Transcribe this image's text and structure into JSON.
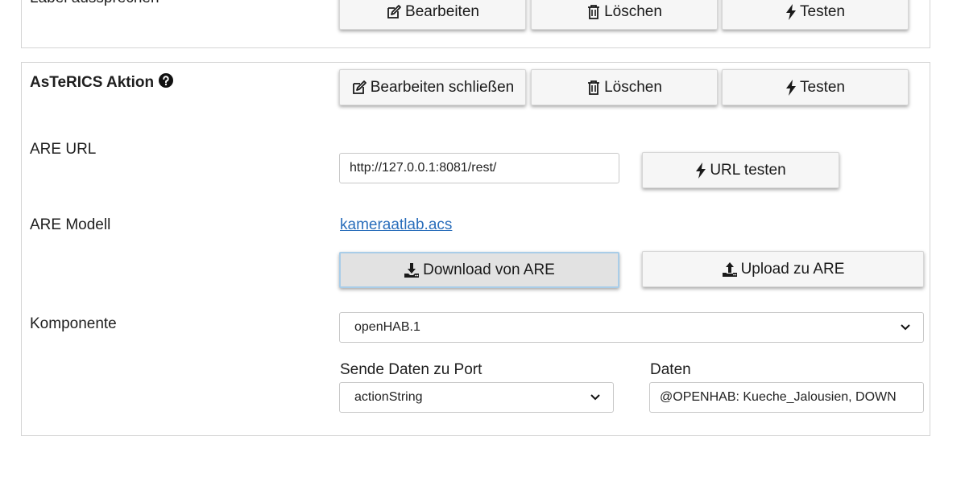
{
  "top_section": {
    "label": "Label aussprechen",
    "edit_label": "Bearbeiten",
    "delete_label": "Löschen",
    "test_label": "Testen"
  },
  "asterics": {
    "title": "AsTeRICS Aktion",
    "close_edit_label": "Bearbeiten schließen",
    "delete_label": "Löschen",
    "test_label": "Testen",
    "are_url_label": "ARE URL",
    "are_url_value": "http://127.0.0.1:8081/rest/",
    "url_test_label": "URL testen",
    "are_model_label": "ARE Modell",
    "model_link": "kameraatlab.acs",
    "download_label": "Download von ARE",
    "upload_label": "Upload zu ARE",
    "component_label": "Komponente",
    "component_value": "openHAB.1",
    "port_label": "Sende Daten zu Port",
    "port_value": "actionString",
    "data_label": "Daten",
    "data_value": "@OPENHAB: Kueche_Jalousien, DOWN"
  },
  "icons": {
    "edit": "edit-icon",
    "delete": "trash-icon",
    "test": "bolt-icon",
    "help": "question-circle-icon",
    "download": "download-icon",
    "upload": "upload-icon",
    "dropdown": "chevron-down-icon"
  },
  "colors": {
    "link": "#2a6ebb",
    "focus_border": "#a9cde8"
  }
}
